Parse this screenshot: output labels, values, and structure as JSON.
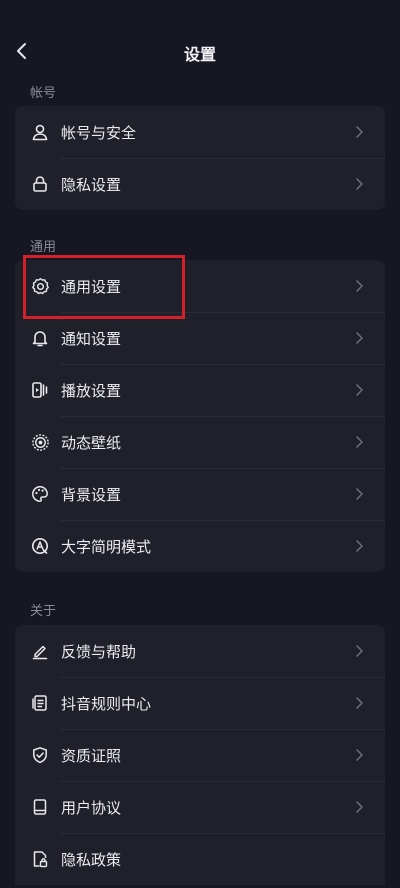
{
  "header": {
    "title": "设置",
    "back_icon": "chevron-left-icon"
  },
  "sections": {
    "account": {
      "label": "帐号",
      "items": [
        {
          "label": "帐号与安全",
          "icon": "user-icon"
        },
        {
          "label": "隐私设置",
          "icon": "lock-icon"
        }
      ]
    },
    "general": {
      "label": "通用",
      "items": [
        {
          "label": "通用设置",
          "icon": "gear-icon"
        },
        {
          "label": "通知设置",
          "icon": "bell-icon"
        },
        {
          "label": "播放设置",
          "icon": "play-settings-icon"
        },
        {
          "label": "动态壁纸",
          "icon": "wallpaper-icon"
        },
        {
          "label": "背景设置",
          "icon": "palette-icon"
        },
        {
          "label": "大字简明模式",
          "icon": "font-size-icon"
        }
      ]
    },
    "about": {
      "label": "关于",
      "items": [
        {
          "label": "反馈与帮助",
          "icon": "edit-icon"
        },
        {
          "label": "抖音规则中心",
          "icon": "rules-doc-icon"
        },
        {
          "label": "资质证照",
          "icon": "shield-check-icon"
        },
        {
          "label": "用户协议",
          "icon": "book-icon"
        },
        {
          "label": "隐私政策",
          "icon": "privacy-doc-icon"
        }
      ]
    }
  },
  "colors": {
    "background": "#161722",
    "card": "#1f2029",
    "text": "#ececf1",
    "muted": "#8a8b96",
    "highlight": "#d3212a"
  }
}
